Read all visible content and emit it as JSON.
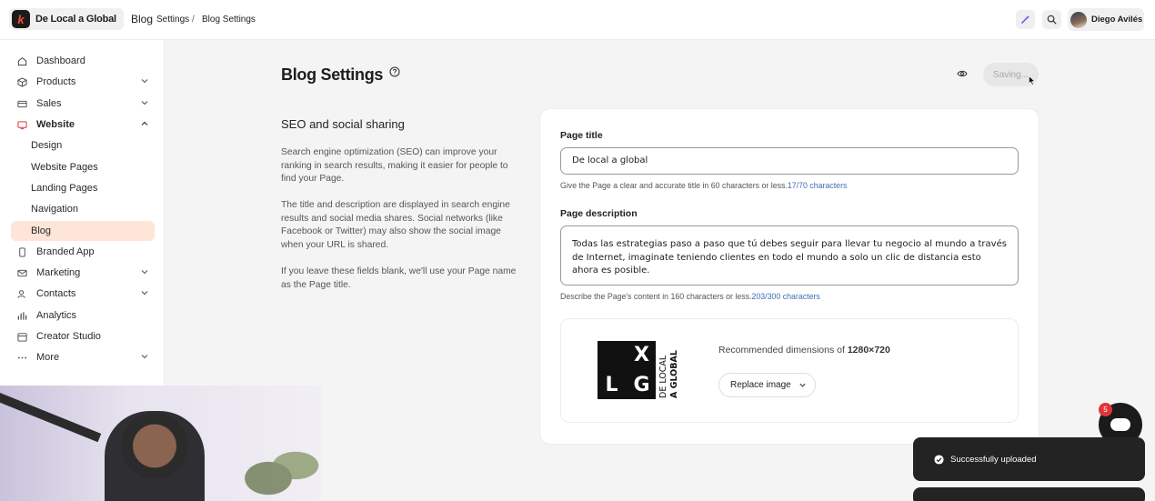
{
  "header": {
    "store_name": "De Local a Global",
    "breadcrumb_root": "Blog",
    "breadcrumb": [
      "Settings",
      "Blog Settings"
    ],
    "breadcrumb_sep": "/",
    "user_name": "Diego Avilés"
  },
  "sidebar": {
    "items": [
      {
        "label": "Dashboard",
        "icon": "home-icon"
      },
      {
        "label": "Products",
        "icon": "box-icon",
        "chevron": "down"
      },
      {
        "label": "Sales",
        "icon": "sales-icon",
        "chevron": "down"
      },
      {
        "label": "Website",
        "icon": "website-icon",
        "chevron": "up",
        "expanded": true
      },
      {
        "label": "Design"
      },
      {
        "label": "Website Pages"
      },
      {
        "label": "Landing Pages"
      },
      {
        "label": "Navigation"
      },
      {
        "label": "Blog",
        "active": true
      },
      {
        "label": "Branded App",
        "icon": "phone-icon"
      },
      {
        "label": "Marketing",
        "icon": "mail-icon",
        "chevron": "down"
      },
      {
        "label": "Contacts",
        "icon": "contacts-icon",
        "chevron": "down"
      },
      {
        "label": "Analytics",
        "icon": "analytics-icon"
      },
      {
        "label": "Creator Studio",
        "icon": "calendar-icon"
      },
      {
        "label": "More",
        "icon": "dots-icon",
        "chevron": "down"
      }
    ]
  },
  "main": {
    "title": "Blog Settings",
    "saving_label": "Saving...",
    "section_heading": "SEO and social sharing",
    "section_paragraphs": [
      "Search engine optimization (SEO) can improve your ranking in search results, making it easier for people to find your Page.",
      "The title and description are displayed in search engine results and social media shares. Social networks (like Facebook or Twitter) may also show the social image when your URL is shared.",
      "If you leave these fields blank, we'll use your Page name as the Page title."
    ],
    "page_title_label": "Page title",
    "page_title_value": "De local a global",
    "page_title_hint": "Give the Page a clear and accurate title in 60 characters or less.",
    "page_title_count": "17/70 characters",
    "page_desc_label": "Page description",
    "page_desc_value": "Todas las estrategias paso a paso que tú debes seguir para llevar tu negocio al mundo a través de Internet, imaginate teniendo clientes en todo el mundo a solo un clic de distancia esto ahora es posible.",
    "page_desc_hint": "Describe the Page's content in 160 characters or less.",
    "page_desc_count": "203/300 characters",
    "image": {
      "logo_letters": [
        "X",
        "L",
        "G"
      ],
      "logo_line1": "DE LOCAL",
      "logo_line2": "A GLOBAL",
      "rec_prefix": "Recommended dimensions of ",
      "rec_dims": "1280×720",
      "replace_label": "Replace image"
    }
  },
  "chat": {
    "badge": "5"
  },
  "toast": {
    "message": "Successfully uploaded"
  },
  "colors": {
    "accent": "#ff4d2e",
    "active_nav": "#fde5d8",
    "link": "#3d6fb6"
  }
}
